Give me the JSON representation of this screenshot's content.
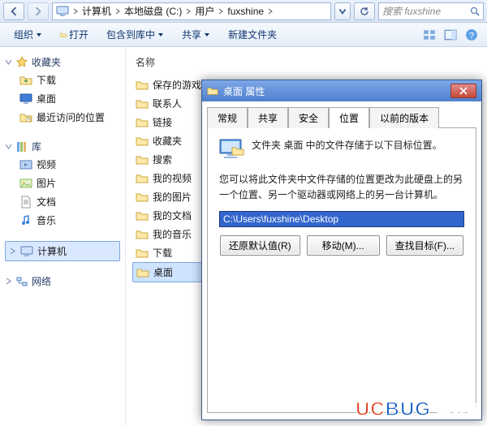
{
  "titlebar": {
    "breadcrumb": [
      "计算机",
      "本地磁盘 (C:)",
      "用户",
      "fuxshine"
    ],
    "search_placeholder": "搜索 fuxshine"
  },
  "toolbar": {
    "organize": "组织",
    "open": "打开",
    "include": "包含到库中",
    "share": "共享",
    "newfolder": "新建文件夹"
  },
  "sidebar": {
    "favorites": {
      "label": "收藏夹",
      "items": [
        "下载",
        "桌面",
        "最近访问的位置"
      ]
    },
    "libraries": {
      "label": "库",
      "items": [
        "视频",
        "图片",
        "文档",
        "音乐"
      ]
    },
    "computer": {
      "label": "计算机"
    },
    "network": {
      "label": "网络"
    }
  },
  "content": {
    "column": "名称",
    "items": [
      "保存的游戏",
      "联系人",
      "链接",
      "收藏夹",
      "搜索",
      "我的视频",
      "我的图片",
      "我的文档",
      "我的音乐",
      "下载",
      "桌面"
    ]
  },
  "dialog": {
    "title": "桌面 属性",
    "tabs": [
      "常规",
      "共享",
      "安全",
      "位置",
      "以前的版本"
    ],
    "active_tab": "位置",
    "line1": "文件夹 桌面 中的文件存储于以下目标位置。",
    "line2": "您可以将此文件夹中文件存储的位置更改为此硬盘上的另一个位置、另一个驱动器或网络上的另一台计算机。",
    "path": "C:\\Users\\fuxshine\\Desktop",
    "buttons": {
      "restore": "还原默认值(R)",
      "move": "移动(M)...",
      "find": "查找目标(F)..."
    }
  },
  "watermark": {
    "brand1": "UC",
    "brand2": "BUG",
    "tail": " 游戏网"
  }
}
